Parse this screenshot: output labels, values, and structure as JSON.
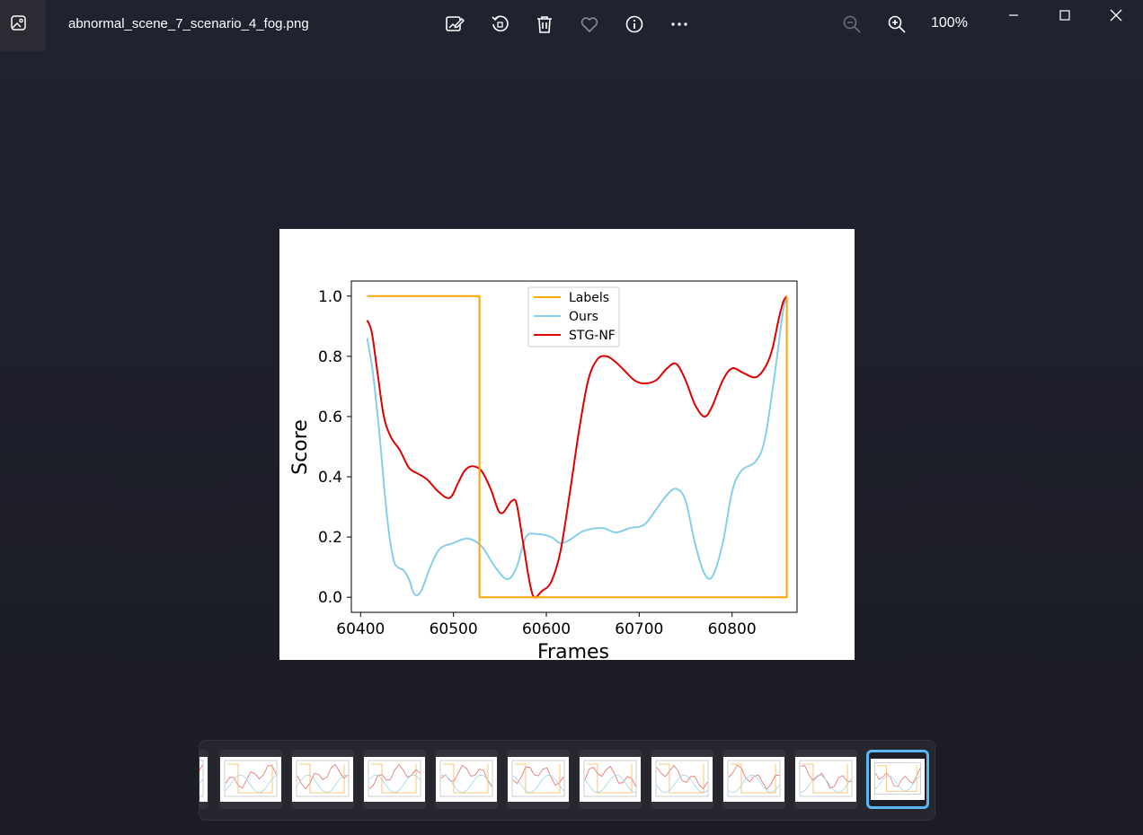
{
  "app": {
    "file_name": "abnormal_scene_7_scenario_4_fog.png",
    "zoom_label": "100%"
  },
  "toolbar": {
    "icons": [
      "edit-image-icon",
      "rotate-icon",
      "delete-icon",
      "favorite-heart-icon",
      "info-icon",
      "more-icon",
      "zoom-out-icon",
      "zoom-in-icon"
    ]
  },
  "window_controls": [
    "minimize-icon",
    "maximize-icon",
    "close-icon"
  ],
  "colors": {
    "labels": "#ffa500",
    "ours": "#87ceeb",
    "stg_nf": "#e00000",
    "selected_thumb_border": "#5cb8f0"
  },
  "chart_data": {
    "type": "line",
    "xlabel": "Frames",
    "ylabel": "Score",
    "xlim": [
      60390,
      60870
    ],
    "ylim": [
      -0.05,
      1.05
    ],
    "x_ticks": [
      "60400",
      "60500",
      "60600",
      "60700",
      "60800"
    ],
    "y_ticks": [
      "0.0",
      "0.2",
      "0.4",
      "0.6",
      "0.8",
      "1.0"
    ],
    "legend_position": "top-center",
    "series": [
      {
        "name": "Labels",
        "color": "#ffa500",
        "x": [
          60407,
          60528,
          60528,
          60859,
          60859
        ],
        "y": [
          1.0,
          1.0,
          0.0,
          0.0,
          1.0
        ]
      },
      {
        "name": "Ours",
        "color": "#87ceeb",
        "x": [
          60407,
          60413,
          60420,
          60428,
          60435,
          60440,
          60446,
          60452,
          60458,
          60465,
          60475,
          60485,
          60500,
          60515,
          60530,
          60545,
          60558,
          60568,
          60578,
          60590,
          60605,
          60615,
          60625,
          60640,
          60660,
          60675,
          60690,
          60705,
          60718,
          60730,
          60740,
          60750,
          60760,
          60770,
          60779,
          60790,
          60800,
          60810,
          60825,
          60835,
          60845,
          60855,
          60859
        ],
        "y": [
          0.86,
          0.75,
          0.55,
          0.28,
          0.13,
          0.1,
          0.09,
          0.06,
          0.01,
          0.02,
          0.1,
          0.16,
          0.18,
          0.195,
          0.17,
          0.1,
          0.06,
          0.1,
          0.2,
          0.21,
          0.2,
          0.18,
          0.19,
          0.22,
          0.23,
          0.215,
          0.23,
          0.24,
          0.29,
          0.34,
          0.36,
          0.32,
          0.18,
          0.08,
          0.07,
          0.18,
          0.35,
          0.42,
          0.45,
          0.52,
          0.72,
          0.95,
          0.99
        ]
      },
      {
        "name": "STG-NF",
        "color": "#e00000",
        "x": [
          60407,
          60412,
          60418,
          60425,
          60433,
          60442,
          60452,
          60462,
          60472,
          60484,
          60496,
          60505,
          60512,
          60520,
          60530,
          60540,
          60548,
          60553,
          60558,
          60563,
          60568,
          60575,
          60582,
          60587,
          60595,
          60605,
          60615,
          60625,
          60635,
          60645,
          60655,
          60665,
          60675,
          60685,
          60695,
          60705,
          60718,
          60730,
          60740,
          60750,
          60760,
          60770,
          60778,
          60790,
          60800,
          60812,
          60825,
          60835,
          60843,
          60850,
          60855,
          60859
        ],
        "y": [
          0.92,
          0.88,
          0.75,
          0.6,
          0.53,
          0.49,
          0.43,
          0.41,
          0.39,
          0.35,
          0.33,
          0.38,
          0.42,
          0.435,
          0.42,
          0.36,
          0.29,
          0.28,
          0.3,
          0.32,
          0.31,
          0.18,
          0.05,
          0.0,
          0.02,
          0.05,
          0.15,
          0.34,
          0.55,
          0.72,
          0.79,
          0.8,
          0.78,
          0.75,
          0.72,
          0.71,
          0.72,
          0.76,
          0.775,
          0.72,
          0.64,
          0.6,
          0.63,
          0.72,
          0.76,
          0.745,
          0.73,
          0.76,
          0.82,
          0.92,
          0.98,
          1.0
        ]
      }
    ]
  },
  "thumbnails": [
    {
      "id": "thumb-0"
    },
    {
      "id": "thumb-1"
    },
    {
      "id": "thumb-2"
    },
    {
      "id": "thumb-3"
    },
    {
      "id": "thumb-4"
    },
    {
      "id": "thumb-5"
    },
    {
      "id": "thumb-6"
    },
    {
      "id": "thumb-7"
    },
    {
      "id": "thumb-8"
    },
    {
      "id": "thumb-9"
    },
    {
      "id": "thumb-10"
    }
  ]
}
